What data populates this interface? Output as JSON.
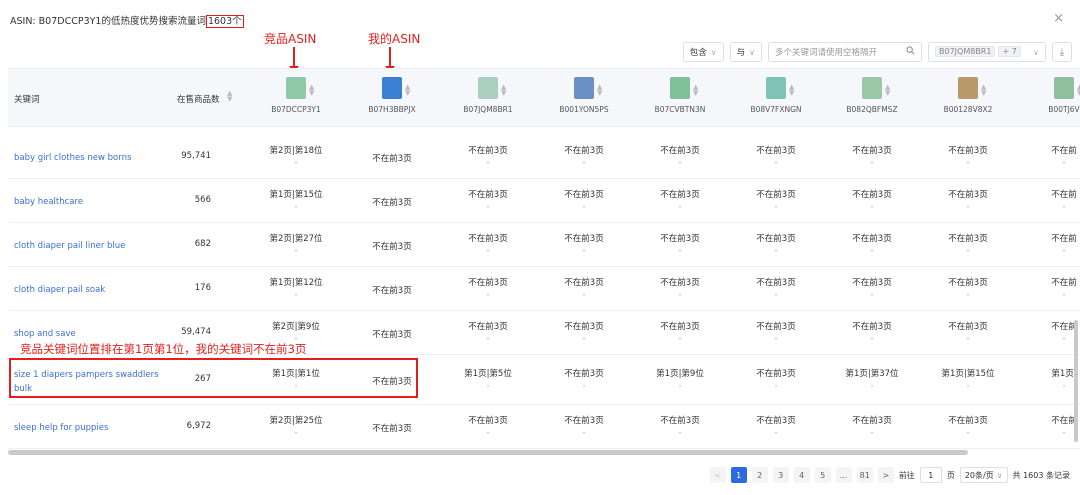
{
  "header": {
    "title_prefix": "ASIN: B07DCCP3Y1的低热度优势搜索流量词",
    "count": "1603个",
    "close": "×"
  },
  "annotations": {
    "competitor_label": "竞品ASIN",
    "mine_label": "我的ASIN",
    "row_note": "竞品关键词位置排在第1页第1位，我的关键词不在前3页"
  },
  "toolbar": {
    "include": "包含",
    "and": "与",
    "search_placeholder": "多个关键词请使用空格隔开",
    "asin_tag": "B07JQM8BR1",
    "asin_more": "+ 7"
  },
  "table": {
    "col_keyword": "关键词",
    "col_count": "在售商品数",
    "asins": [
      "B07DCCP3Y1",
      "B07H3BBPJX",
      "B07JQM8BR1",
      "B001YON5PS",
      "B07CVBTN3N",
      "B08V7FXNGN",
      "B082QBFMSZ",
      "B00128V8X2",
      "B00TJ6V"
    ],
    "rows": [
      {
        "keyword": "baby girl clothes new borns",
        "count": "95,741",
        "cells": [
          "第2页|第18位",
          "不在前3页",
          "不在前3页",
          "不在前3页",
          "不在前3页",
          "不在前3页",
          "不在前3页",
          "不在前3页",
          "不在前"
        ]
      },
      {
        "keyword": "baby healthcare",
        "count": "566",
        "cells": [
          "第1页|第15位",
          "不在前3页",
          "不在前3页",
          "不在前3页",
          "不在前3页",
          "不在前3页",
          "不在前3页",
          "不在前3页",
          "不在前"
        ]
      },
      {
        "keyword": "cloth diaper pail liner blue",
        "count": "682",
        "cells": [
          "第2页|第27位",
          "不在前3页",
          "不在前3页",
          "不在前3页",
          "不在前3页",
          "不在前3页",
          "不在前3页",
          "不在前3页",
          "不在前"
        ]
      },
      {
        "keyword": "cloth diaper pail soak",
        "count": "176",
        "cells": [
          "第1页|第12位",
          "不在前3页",
          "不在前3页",
          "不在前3页",
          "不在前3页",
          "不在前3页",
          "不在前3页",
          "不在前3页",
          "不在前"
        ]
      },
      {
        "keyword": "shop and save",
        "count": "59,474",
        "cells": [
          "第2页|第9位",
          "不在前3页",
          "不在前3页",
          "不在前3页",
          "不在前3页",
          "不在前3页",
          "不在前3页",
          "不在前3页",
          "不在前"
        ]
      },
      {
        "keyword": "size 1 diapers pampers swaddlers bulk",
        "count": "267",
        "cells": [
          "第1页|第1位",
          "不在前3页",
          "第1页|第5位",
          "不在前3页",
          "第1页|第9位",
          "不在前3页",
          "第1页|第37位",
          "第1页|第15位",
          "第1页|"
        ]
      },
      {
        "keyword": "sleep help for puppies",
        "count": "6,972",
        "cells": [
          "第2页|第25位",
          "不在前3页",
          "不在前3页",
          "不在前3页",
          "不在前3页",
          "不在前3页",
          "不在前3页",
          "不在前3页",
          "不在前"
        ]
      }
    ],
    "sub": "-"
  },
  "pager": {
    "prev": "<",
    "pages": [
      "1",
      "2",
      "3",
      "4",
      "5",
      "...",
      "81"
    ],
    "next": ">",
    "goto_label": "前往",
    "goto_value": "1",
    "page_unit": "页",
    "size": "20条/页",
    "total": "共 1603 条记录"
  },
  "colors": {
    "accent": "#2d6ae0",
    "annotation": "#e02020",
    "link": "#3b6fd6"
  }
}
